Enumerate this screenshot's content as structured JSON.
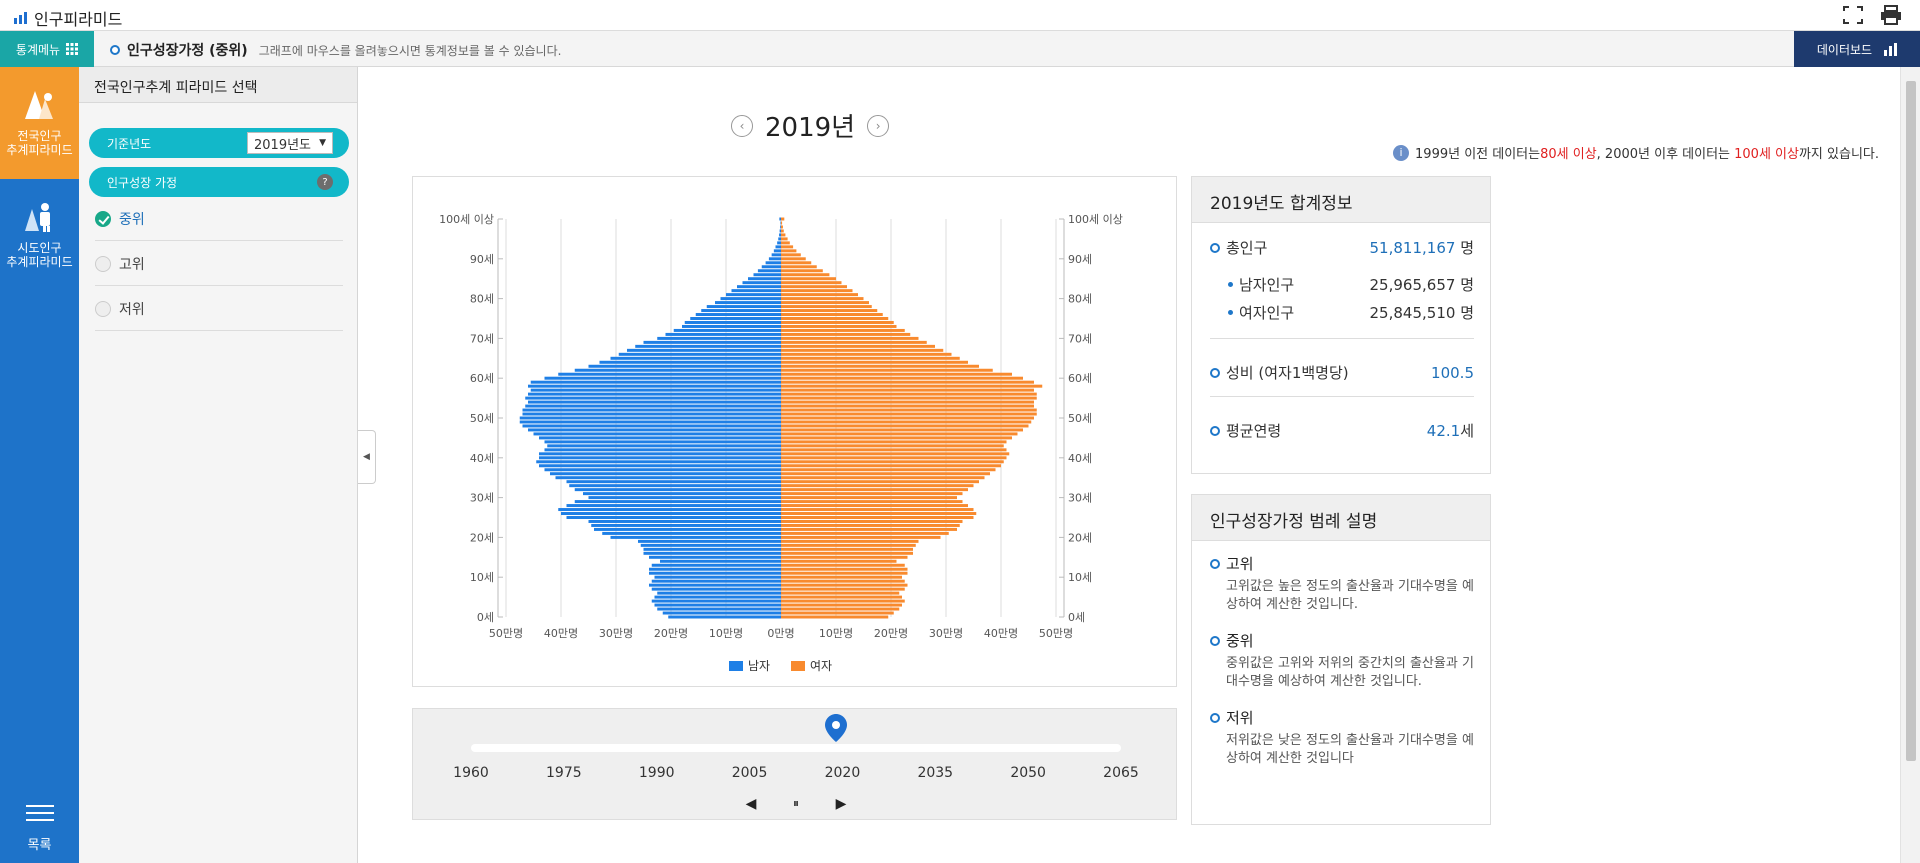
{
  "app": {
    "title": "인구피라미드"
  },
  "subbar": {
    "menu_label": "통계메뉴",
    "page_title": "인구성장가정 (중위)",
    "hint": "그래프에 마우스를 올려놓으시면 통계정보를 볼 수 있습니다.",
    "dashboard_label": "데이터보드"
  },
  "leftnav": {
    "items": [
      {
        "label": "전국인구\n추계피라미드",
        "icon": "pyramid-icon",
        "active": true
      },
      {
        "label": "시도인구\n추계피라미드",
        "icon": "people-icon",
        "active": false
      }
    ],
    "bottom_label": "목록"
  },
  "panel": {
    "header": "전국인구추계 피라미드 선택",
    "base_year_label": "기준년도",
    "base_year_value": "2019년도",
    "growth_label": "인구성장 가정",
    "help_glyph": "?",
    "options": [
      {
        "label": "중위",
        "checked": true
      },
      {
        "label": "고위",
        "checked": false
      },
      {
        "label": "저위",
        "checked": false
      }
    ]
  },
  "main": {
    "year_title": "2019년",
    "info_parts": [
      "1999년 이전 데이터는",
      "80세 이상",
      ", 2000년 이후 데이터는 ",
      "100세 이상",
      "까지 있습니다."
    ]
  },
  "timeline": {
    "years": [
      "1960",
      "1975",
      "1990",
      "2005",
      "2020",
      "2035",
      "2050",
      "2065"
    ],
    "current_year": 2019,
    "prev_glyph": "◀",
    "pause_glyph": "⏸",
    "next_glyph": "▶"
  },
  "summary": {
    "title": "2019년도 합계정보",
    "total_label": "총인구",
    "total_value": "51,811,167",
    "unit_person": "명",
    "male_label": "남자인구",
    "male_value": "25,965,657",
    "female_label": "여자인구",
    "female_value": "25,845,510",
    "ratio_label": "성비 (여자1백명당)",
    "ratio_value": "100.5",
    "age_label": "평균연령",
    "age_value": "42.1",
    "age_unit": "세"
  },
  "legend_card": {
    "title": "인구성장가정 범례 설명",
    "items": [
      {
        "title": "고위",
        "desc": "고위값은 높은 정도의 출산율과 기대수명을 예상하여 계산한 것입니다."
      },
      {
        "title": "중위",
        "desc": "중위값은 고위와 저위의 중간치의 출산율과 기대수명을 예상하여 계산한 것입니다."
      },
      {
        "title": "저위",
        "desc": "저위값은 낮은 정도의 출산율과 기대수명을 예상하여 계산한 것입니다"
      }
    ]
  },
  "colors": {
    "male": "#1e7fe6",
    "female": "#f88a2e",
    "accent_teal": "#12b8c9",
    "nav_blue": "#1e73c9",
    "nav_active": "#f39a2d",
    "dashboard_navy": "#1e3a6e"
  },
  "chart_data": {
    "type": "bar",
    "orientation": "horizontal-pyramid",
    "unit": "만명",
    "xlim": [
      -50,
      50
    ],
    "x_ticks": [
      "50만명",
      "40만명",
      "30만명",
      "20만명",
      "10만명",
      "0만명",
      "10만명",
      "20만명",
      "30만명",
      "40만명",
      "50만명"
    ],
    "y_ticks": [
      "0세",
      "10세",
      "20세",
      "30세",
      "40세",
      "50세",
      "60세",
      "70세",
      "80세",
      "90세",
      "100세 이상"
    ],
    "ages": [
      0,
      1,
      2,
      3,
      4,
      5,
      6,
      7,
      8,
      9,
      10,
      11,
      12,
      13,
      14,
      15,
      16,
      17,
      18,
      19,
      20,
      21,
      22,
      23,
      24,
      25,
      26,
      27,
      28,
      29,
      30,
      31,
      32,
      33,
      34,
      35,
      36,
      37,
      38,
      39,
      40,
      41,
      42,
      43,
      44,
      45,
      46,
      47,
      48,
      49,
      50,
      51,
      52,
      53,
      54,
      55,
      56,
      57,
      58,
      59,
      60,
      61,
      62,
      63,
      64,
      65,
      66,
      67,
      68,
      69,
      70,
      71,
      72,
      73,
      74,
      75,
      76,
      77,
      78,
      79,
      80,
      81,
      82,
      83,
      84,
      85,
      86,
      87,
      88,
      89,
      90,
      91,
      92,
      93,
      94,
      95,
      96,
      97,
      98,
      99,
      100
    ],
    "series": [
      {
        "name": "남자",
        "values": [
          20.5,
          21.5,
          22.5,
          23.0,
          23.5,
          23.0,
          22.5,
          23.5,
          24.0,
          23.5,
          23.0,
          24.0,
          24.0,
          23.5,
          22.0,
          24.0,
          25.0,
          25.0,
          25.5,
          26.0,
          31.0,
          32.5,
          34.0,
          34.5,
          35.0,
          39.0,
          40.0,
          40.5,
          39.0,
          37.5,
          35.0,
          36.0,
          37.5,
          38.5,
          39.0,
          41.0,
          42.0,
          43.0,
          44.0,
          44.5,
          44.0,
          44.0,
          43.0,
          42.5,
          43.0,
          44.0,
          45.0,
          46.0,
          47.0,
          47.5,
          47.5,
          47.0,
          47.0,
          46.5,
          46.0,
          46.5,
          46.0,
          45.5,
          46.0,
          45.5,
          43.0,
          40.5,
          37.5,
          35.0,
          33.0,
          31.0,
          29.5,
          28.0,
          26.5,
          25.0,
          22.5,
          21.0,
          19.5,
          18.0,
          17.5,
          16.5,
          15.5,
          14.5,
          13.5,
          12.0,
          11.0,
          10.0,
          9.0,
          8.0,
          7.0,
          6.0,
          5.0,
          4.2,
          3.5,
          2.8,
          2.2,
          1.7,
          1.3,
          1.0,
          0.7,
          0.5,
          0.35,
          0.25,
          0.15,
          0.1,
          0.3
        ]
      },
      {
        "name": "여자",
        "values": [
          19.5,
          20.5,
          21.5,
          22.0,
          22.5,
          22.0,
          21.5,
          22.5,
          23.0,
          22.5,
          22.0,
          23.0,
          23.0,
          22.5,
          21.0,
          23.0,
          24.0,
          24.0,
          24.5,
          25.0,
          29.0,
          30.5,
          32.0,
          32.5,
          33.0,
          35.0,
          35.5,
          35.0,
          34.0,
          33.0,
          32.0,
          33.0,
          34.0,
          35.0,
          36.0,
          37.0,
          38.0,
          39.0,
          40.0,
          40.5,
          41.0,
          41.5,
          41.0,
          40.5,
          41.0,
          42.0,
          43.0,
          44.0,
          45.0,
          45.5,
          46.0,
          46.5,
          46.5,
          46.0,
          46.0,
          46.5,
          46.5,
          46.0,
          47.5,
          46.0,
          44.0,
          42.0,
          38.5,
          36.0,
          34.0,
          32.5,
          31.0,
          29.5,
          28.0,
          26.5,
          25.0,
          23.5,
          22.5,
          21.0,
          20.5,
          19.5,
          18.5,
          17.5,
          16.5,
          16.0,
          15.0,
          14.0,
          13.0,
          12.0,
          11.0,
          10.0,
          8.8,
          7.6,
          6.5,
          5.5,
          4.5,
          3.6,
          2.8,
          2.2,
          1.6,
          1.2,
          0.8,
          0.5,
          0.35,
          0.2,
          0.6
        ]
      }
    ],
    "legend": [
      "남자",
      "여자"
    ],
    "legend_position": "bottom",
    "grid": true
  }
}
